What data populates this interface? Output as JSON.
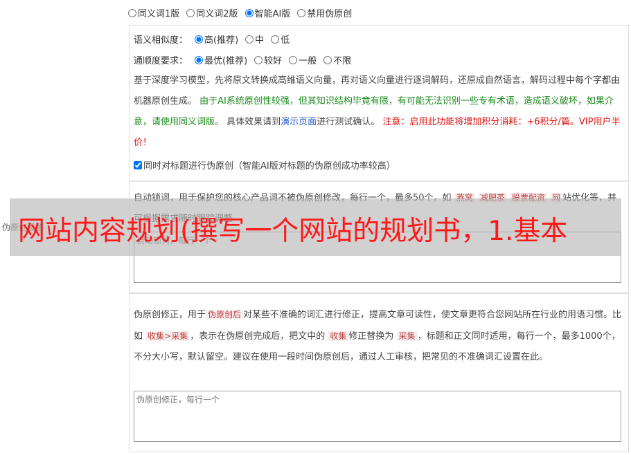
{
  "version_options": [
    {
      "label": "同义词1版",
      "checked": false
    },
    {
      "label": "同义词2版",
      "checked": false
    },
    {
      "label": "智能AI版",
      "checked": true
    },
    {
      "label": "禁用伪原创",
      "checked": false
    }
  ],
  "similarity": {
    "label": "语义相似度：",
    "options": [
      {
        "label": "高(推荐)",
        "checked": true
      },
      {
        "label": "中",
        "checked": false
      },
      {
        "label": "低",
        "checked": false
      }
    ]
  },
  "fluency": {
    "label": "通顺度要求：",
    "options": [
      {
        "label": "最优(推荐)",
        "checked": true
      },
      {
        "label": "较好",
        "checked": false
      },
      {
        "label": "一般",
        "checked": false
      },
      {
        "label": "不限",
        "checked": false
      }
    ]
  },
  "description": {
    "part1": "基于深度学习模型，先将原文转换成高维语义向量，再对语义向量进行逐词解码，还原成自然语言，解码过程中每个字都由机器原创生成。",
    "green_note": "由于AI系统原创性较强，但其知识结构毕竟有限，有可能无法识别一些专有术语，造成语义破坏，如果介意，请使用同义词版。",
    "part2": "具体效果请到",
    "demo_link": "演示页面",
    "part3": "进行测试确认。",
    "red_note": "注意：启用此功能将增加积分消耗：+6积分/篇。VIP用户半价！"
  },
  "title_checkbox": {
    "label": "同时对标题进行伪原创（智能AI版对标题的伪原创成功率较高）",
    "checked": true
  },
  "side_label": "伪原创设置",
  "lock_words": {
    "text_before": "自动锁词，用于保护您的核心产品词不被伪原创修改，每行一个，最多50个，如",
    "examples": [
      "燕窝",
      "减肥茶",
      "股票配资",
      "网"
    ],
    "text_after": "站优化等，并可根据需求随时跟踪调整",
    "placeholder": "自动锁词，每行一个"
  },
  "correction": {
    "text1": "伪原创修正，用于",
    "kw1": "伪原创后",
    "text2": "对某些不准确的词汇进行修正，提高文章可读性，使文章更符合您网站所在行业的用语习惯。比如",
    "kw2": "收集>采集",
    "text3": "，表示在伪原创完成后，把文中的",
    "kw3": "收集",
    "text4": "修正替换为",
    "kw4": "采集",
    "text5": "，标题和正文同时适用，每行一个，最多1000个，不分大小写，默认留空。建议在使用一段时间伪原创后，通过人工审核，把常见的不准确词汇设置在此。",
    "placeholder": "伪原创修正，每行一个"
  },
  "overlay_title": "网站内容规划(撰写一个网站的规划书，1.基本"
}
